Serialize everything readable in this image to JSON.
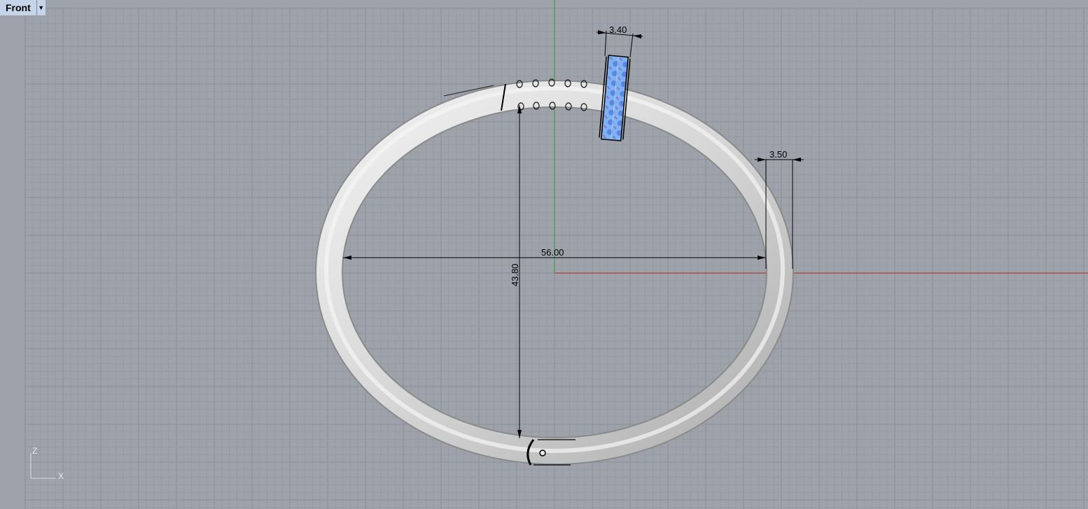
{
  "viewport": {
    "name": "Front",
    "menu_icon": "dropdown-arrow-icon"
  },
  "dimensions": {
    "width": "56.00",
    "height": "43.80",
    "tube": "3.50",
    "band": "3.40"
  },
  "axes": {
    "vertical": "Z",
    "horizontal": "X"
  },
  "colors": {
    "background": "#9ea3ab",
    "grid_minor": "#959aa2",
    "grid_major": "#8a8f97",
    "x_axis": "#b0403a",
    "z_axis": "#3fa04a",
    "ring": "#dcdcdc",
    "band": "#8ab8f0"
  }
}
